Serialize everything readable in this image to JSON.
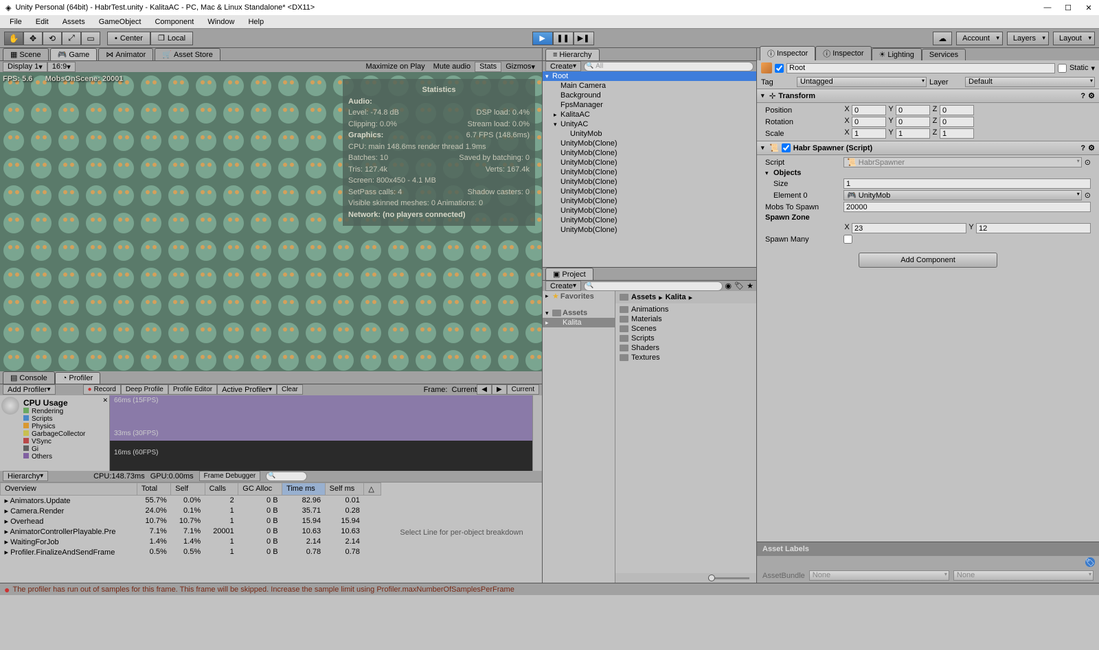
{
  "window_title": "Unity Personal (64bit) - HabrTest.unity - KalitaAC - PC, Mac & Linux Standalone* <DX11>",
  "menu": [
    "File",
    "Edit",
    "Assets",
    "GameObject",
    "Component",
    "Window",
    "Help"
  ],
  "topbar": {
    "center": "Center",
    "local": "Local",
    "account": "Account",
    "layers": "Layers",
    "layout": "Layout"
  },
  "scene_tabs": {
    "scene": "Scene",
    "game": "Game",
    "animator": "Animator",
    "asset_store": "Asset Store"
  },
  "game_toolbar": {
    "display": "Display 1",
    "aspect": "16:9",
    "maximize": "Maximize on Play",
    "mute": "Mute audio",
    "stats": "Stats",
    "gizmos": "Gizmos"
  },
  "game_overlay": {
    "fps": "FPS: 5.6",
    "mobs": "MobsOnScene: 20001"
  },
  "stats": {
    "title": "Statistics",
    "audio": "Audio:",
    "level": "Level: -74.8 dB",
    "dsp": "DSP load: 0.4%",
    "clipping": "Clipping: 0.0%",
    "stream": "Stream load: 0.0%",
    "graphics": "Graphics:",
    "gfps": "6.7 FPS (148.6ms)",
    "cpu": "CPU: main 148.6ms  render thread 1.9ms",
    "batches": "Batches: 10",
    "saved": "Saved by batching: 0",
    "tris": "Tris: 127.4k",
    "verts": "Verts: 167.4k",
    "screen": "Screen: 800x450 - 4.1 MB",
    "setpass": "SetPass calls: 4",
    "shadow": "Shadow casters: 0",
    "skinned": "Visible skinned meshes: 0  Animations: 0",
    "network": "Network: (no players connected)"
  },
  "bottom_tabs": {
    "console": "Console",
    "profiler": "Profiler"
  },
  "profiler_toolbar": {
    "add": "Add Profiler",
    "record": "Record",
    "deep": "Deep Profile",
    "editor": "Profile Editor",
    "active": "Active Profiler",
    "clear": "Clear",
    "frame": "Frame:",
    "current": "Current",
    "current2": "Current"
  },
  "profiler_cpu": {
    "title": "CPU Usage",
    "items": [
      {
        "c": "#6aa860",
        "t": "Rendering"
      },
      {
        "c": "#4a88c8",
        "t": "Scripts"
      },
      {
        "c": "#d89830",
        "t": "Physics"
      },
      {
        "c": "#c8c050",
        "t": "GarbageCollector"
      },
      {
        "c": "#b84848",
        "t": "VSync"
      },
      {
        "c": "#606060",
        "t": "Gi"
      },
      {
        "c": "#8060a0",
        "t": "Others"
      }
    ],
    "lines": [
      {
        "p": "2px",
        "t": "66ms (15FPS)"
      },
      {
        "p": "50px",
        "t": "33ms (30FPS)"
      },
      {
        "p": "78px",
        "t": "16ms (60FPS)"
      }
    ]
  },
  "profiler_info": {
    "hierarchy": "Hierarchy",
    "cpu": "CPU:148.73ms",
    "gpu": "GPU:0.00ms",
    "frame_dbg": "Frame Debugger"
  },
  "profiler_table": {
    "cols": [
      "Overview",
      "Total",
      "Self",
      "Calls",
      "GC Alloc",
      "Time ms",
      "Self ms"
    ],
    "rows": [
      [
        "Animators.Update",
        "55.7%",
        "0.0%",
        "2",
        "0 B",
        "82.96",
        "0.01"
      ],
      [
        "Camera.Render",
        "24.0%",
        "0.1%",
        "1",
        "0 B",
        "35.71",
        "0.28"
      ],
      [
        "Overhead",
        "10.7%",
        "10.7%",
        "1",
        "0 B",
        "15.94",
        "15.94"
      ],
      [
        "AnimatorControllerPlayable.Pre",
        "7.1%",
        "7.1%",
        "20001",
        "0 B",
        "10.63",
        "10.63"
      ],
      [
        "WaitingForJob",
        "1.4%",
        "1.4%",
        "1",
        "0 B",
        "2.14",
        "2.14"
      ],
      [
        "Profiler.FinalizeAndSendFrame",
        "0.5%",
        "0.5%",
        "1",
        "0 B",
        "0.78",
        "0.78"
      ]
    ],
    "detail_hint": "Select Line for per-object breakdown"
  },
  "hierarchy": {
    "tab": "Hierarchy",
    "create": "Create",
    "items": [
      {
        "d": 0,
        "exp": "down",
        "t": "Root",
        "sel": true
      },
      {
        "d": 1,
        "exp": "",
        "t": "Main Camera"
      },
      {
        "d": 1,
        "exp": "",
        "t": "Background"
      },
      {
        "d": 1,
        "exp": "",
        "t": "FpsManager"
      },
      {
        "d": 1,
        "exp": "right",
        "t": "KalitaAC"
      },
      {
        "d": 1,
        "exp": "down",
        "t": "UnityAC"
      },
      {
        "d": 2,
        "exp": "",
        "t": "UnityMob"
      },
      {
        "d": 1,
        "exp": "",
        "t": "UnityMob(Clone)"
      },
      {
        "d": 1,
        "exp": "",
        "t": "UnityMob(Clone)"
      },
      {
        "d": 1,
        "exp": "",
        "t": "UnityMob(Clone)"
      },
      {
        "d": 1,
        "exp": "",
        "t": "UnityMob(Clone)"
      },
      {
        "d": 1,
        "exp": "",
        "t": "UnityMob(Clone)"
      },
      {
        "d": 1,
        "exp": "",
        "t": "UnityMob(Clone)"
      },
      {
        "d": 1,
        "exp": "",
        "t": "UnityMob(Clone)"
      },
      {
        "d": 1,
        "exp": "",
        "t": "UnityMob(Clone)"
      },
      {
        "d": 1,
        "exp": "",
        "t": "UnityMob(Clone)"
      },
      {
        "d": 1,
        "exp": "",
        "t": "UnityMob(Clone)"
      }
    ]
  },
  "project": {
    "tab": "Project",
    "create": "Create",
    "favorites": "Favorites",
    "assets": "Assets",
    "kalita": "Kalita",
    "bc_assets": "Assets",
    "bc_kalita": "Kalita",
    "folders": [
      "Animations",
      "Materials",
      "Scenes",
      "Scripts",
      "Shaders",
      "Textures"
    ]
  },
  "inspector": {
    "tabs": [
      "Inspector",
      "Inspector",
      "Lighting",
      "Services"
    ],
    "name": "Root",
    "static": "Static",
    "tag": "Tag",
    "tag_val": "Untagged",
    "layer": "Layer",
    "layer_val": "Default",
    "transform": "Transform",
    "position": "Position",
    "rotation": "Rotation",
    "scale": "Scale",
    "pos": {
      "x": "0",
      "y": "0",
      "z": "0"
    },
    "rot": {
      "x": "0",
      "y": "0",
      "z": "0"
    },
    "scl": {
      "x": "1",
      "y": "1",
      "z": "1"
    },
    "habr": "Habr Spawner (Script)",
    "script": "Script",
    "script_val": "HabrSpawner",
    "objects": "Objects",
    "size": "Size",
    "size_val": "1",
    "element0": "Element 0",
    "element0_val": "UnityMob",
    "mobs": "Mobs To Spawn",
    "mobs_val": "20000",
    "zone": "Spawn Zone",
    "zx": "23",
    "zy": "12",
    "spawn_many": "Spawn Many",
    "add_component": "Add Component",
    "asset_labels": "Asset Labels",
    "asset_bundle": "AssetBundle",
    "none": "None"
  },
  "status": "The profiler has run out of samples for this frame. This frame will be skipped. Increase the sample limit using Profiler.maxNumberOfSamplesPerFrame"
}
